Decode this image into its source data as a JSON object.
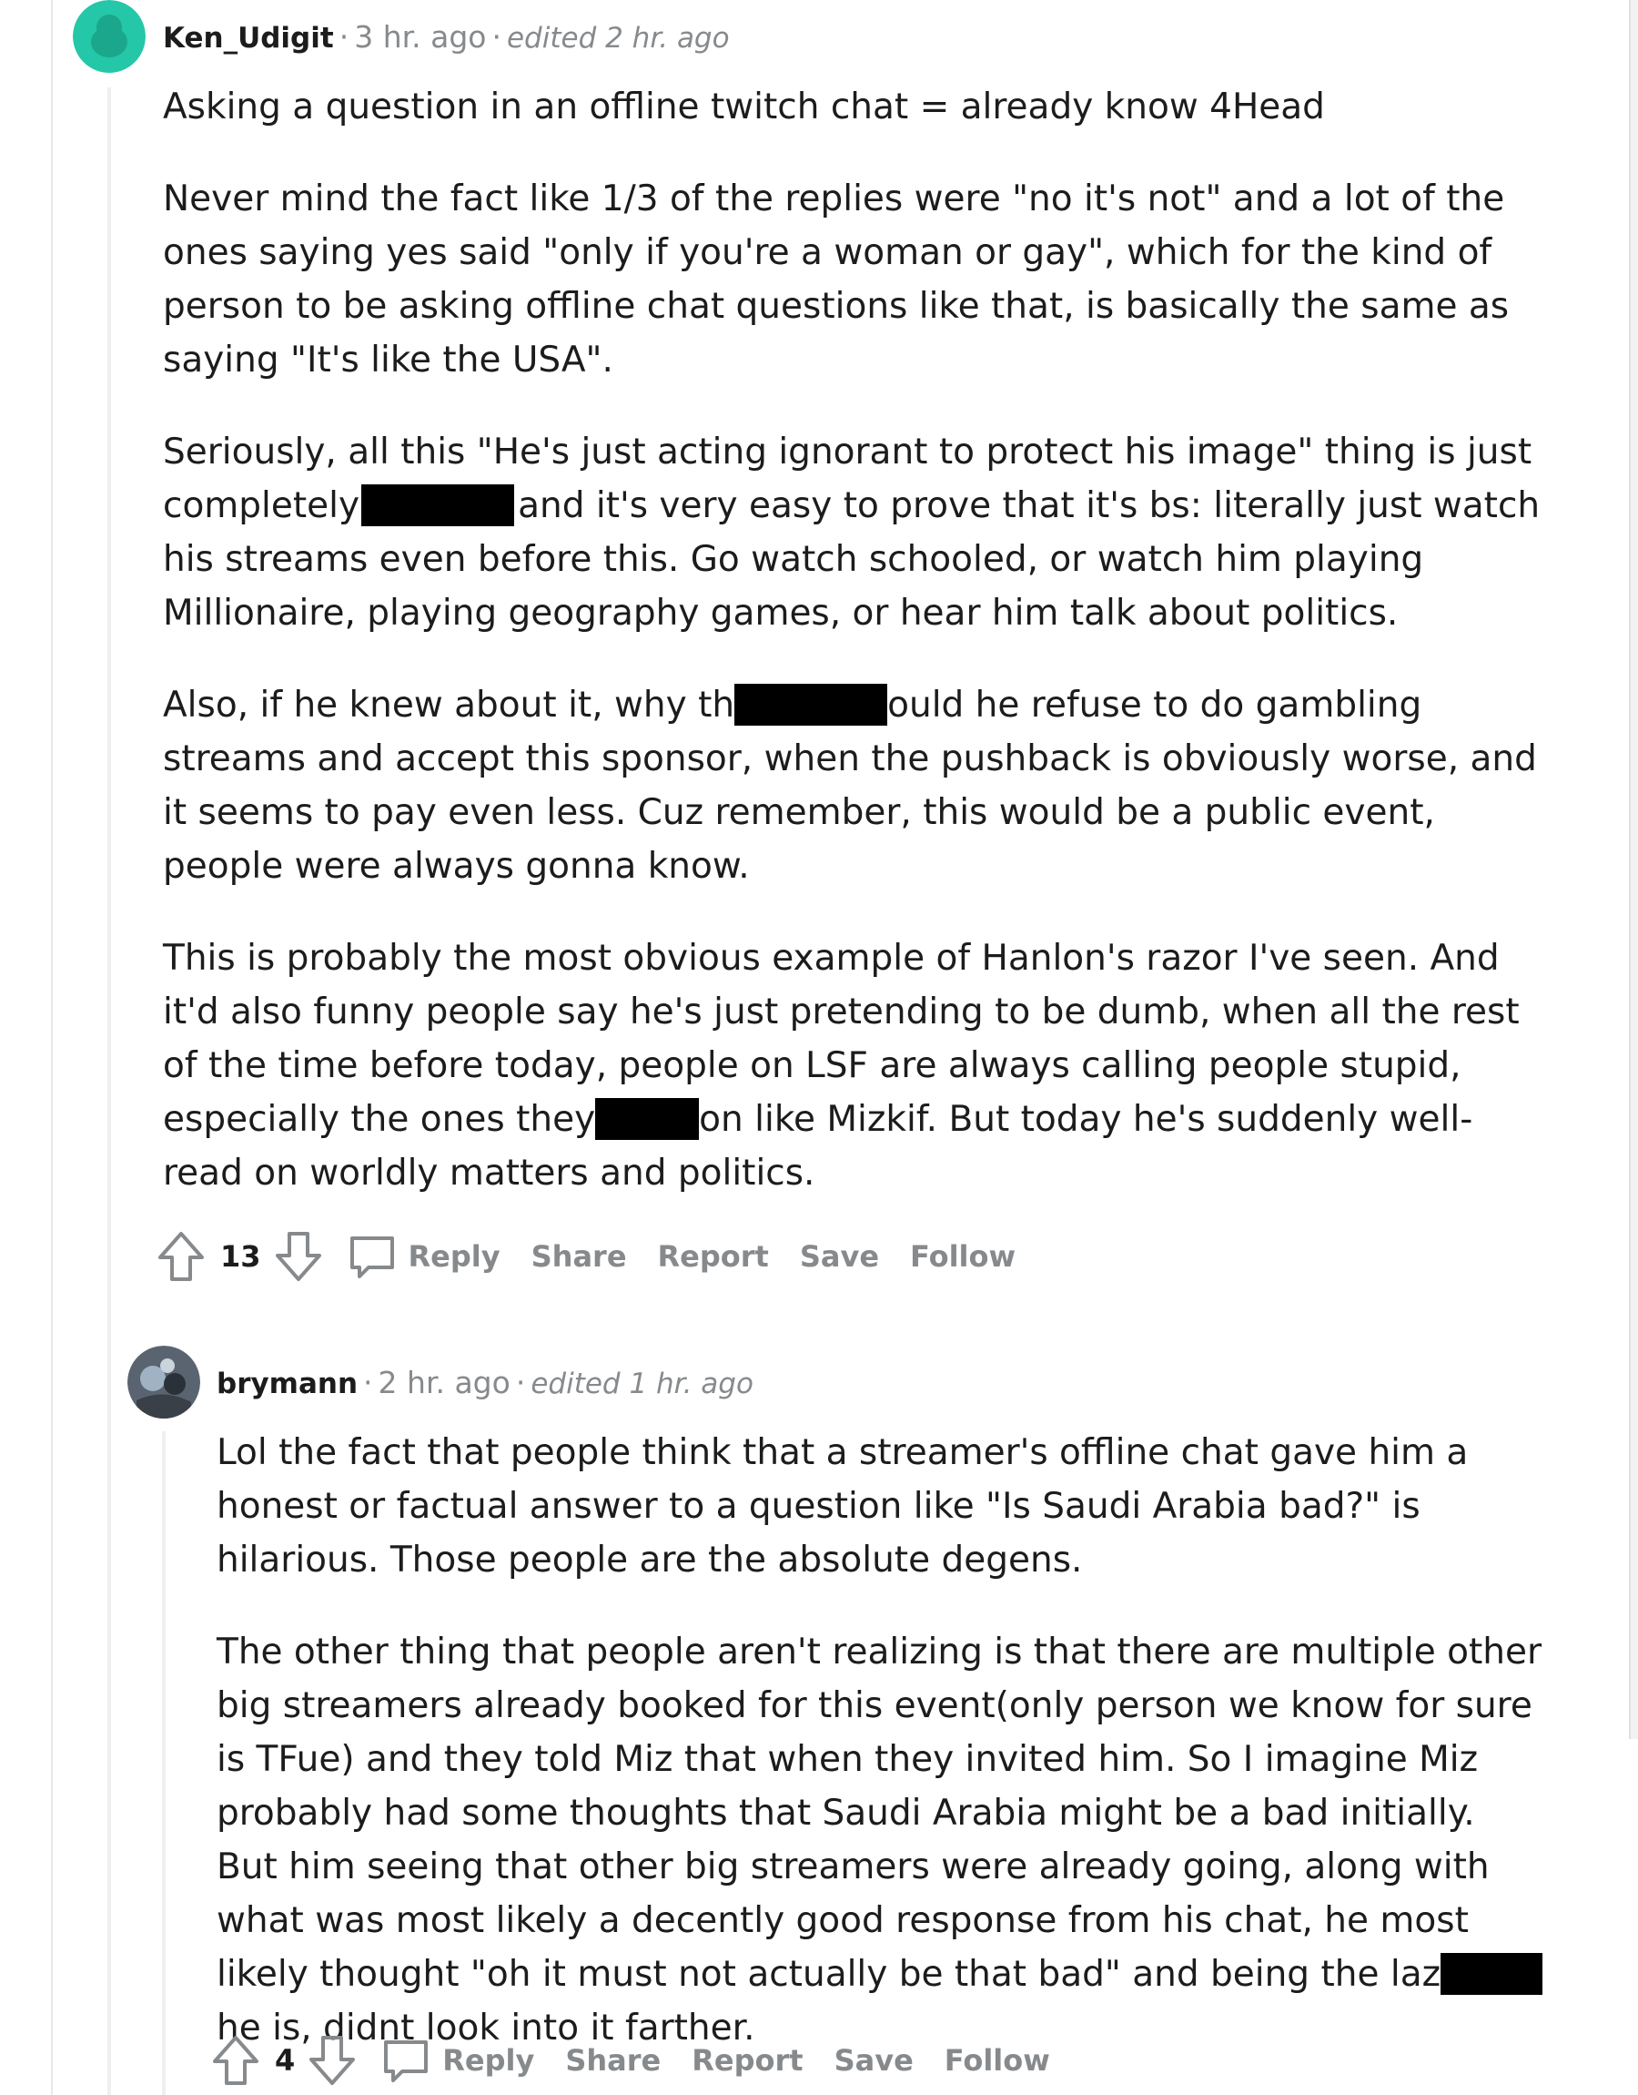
{
  "comments": [
    {
      "username": "Ken_Udigit",
      "time": "3 hr. ago",
      "edited": "edited 2 hr. ago",
      "avatar_color": "#24c7a7",
      "paragraphs": [
        [
          "Asking a question in an offline twitch chat = already know 4Head"
        ],
        [
          "Never mind the fact like 1/3 of the replies were \"no it's not\" and a lot of the ones saying yes said \"only if you're a woman or gay\", which for the kind of person to be asking offline chat questions like that, is basically the same as saying \"It's like the USA\"."
        ],
        [
          "Seriously, all this \"He's just acting ignorant to protect his image\" thing is just completely",
          "and it's very easy to prove that it's bs: literally just watch his streams even before this. Go watch schooled, or watch him playing Millionaire, playing geography games, or hear him talk about politics."
        ],
        [
          "Also, if he knew about it, why th",
          "ould he refuse to do gambling streams and accept this sponsor, when the pushback is obviously worse, and it seems to pay even less. Cuz remember, this would be a public event, people were always gonna know."
        ],
        [
          "This is probably the most obvious example of Hanlon's razor I've seen. And it'd also funny people say he's just pretending to be dumb, when all the rest of the time before today, people on LSF are always calling people stupid, especially the ones they",
          "on like Mizkif. But today he's suddenly well-read on worldly matters and politics."
        ]
      ],
      "votes": "13",
      "actions": {
        "reply": "Reply",
        "share": "Share",
        "report": "Report",
        "save": "Save",
        "follow": "Follow"
      }
    },
    {
      "username": "brymann",
      "time": "2 hr. ago",
      "edited": "edited 1 hr. ago",
      "paragraphs": [
        [
          "Lol the fact that people think that a streamer's offline chat gave him a honest or factual answer to a question like \"Is Saudi Arabia bad?\" is hilarious. Those people are the absolute degens."
        ],
        [
          "The other thing that people aren't realizing is that there are multiple other big streamers already booked for this event(only person we know for sure is TFue) and they told Miz that when they invited him. So I imagine Miz probably had some thoughts that Saudi Arabia might be a bad initially. But him seeing that other big streamers were already going, along with what was most likely a decently good response from his chat, he most likely thought \"oh it must not actually be that bad\" and being the laz",
          "he is, didnt look into it farther."
        ]
      ],
      "votes": "4",
      "actions": {
        "reply": "Reply",
        "share": "Share",
        "report": "Report",
        "save": "Save",
        "follow": "Follow"
      }
    }
  ]
}
